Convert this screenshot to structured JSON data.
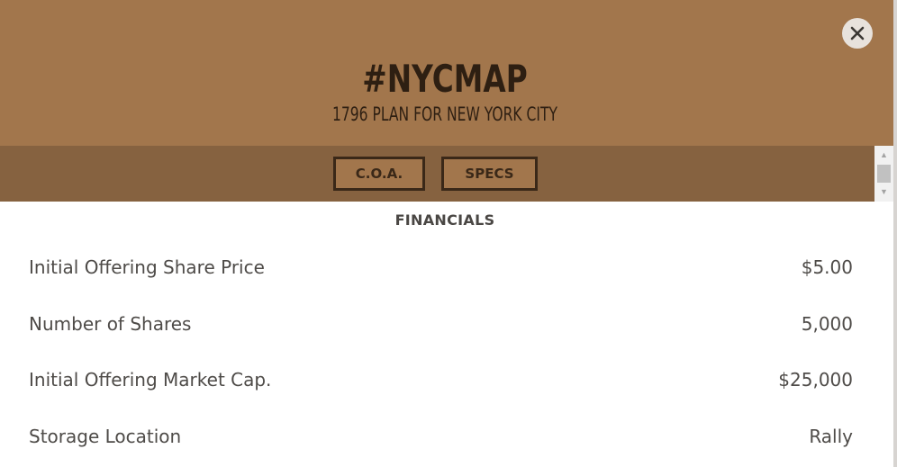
{
  "header": {
    "title": "#NYCMAP",
    "subtitle": "1796 PLAN FOR NEW YORK CITY",
    "close_icon": "close-icon",
    "background_color": "#a2764c"
  },
  "tabs": [
    {
      "label": "C.O.A."
    },
    {
      "label": "SPECS"
    }
  ],
  "tabbar": {
    "background_color": "#866240"
  },
  "section": {
    "heading": "FINANCIALS"
  },
  "financials": [
    {
      "label": "Initial Offering Share Price",
      "value": "$5.00"
    },
    {
      "label": "Number of Shares",
      "value": "5,000"
    },
    {
      "label": "Initial Offering Market Cap.",
      "value": "$25,000"
    },
    {
      "label": "Storage Location",
      "value": "Rally"
    }
  ]
}
